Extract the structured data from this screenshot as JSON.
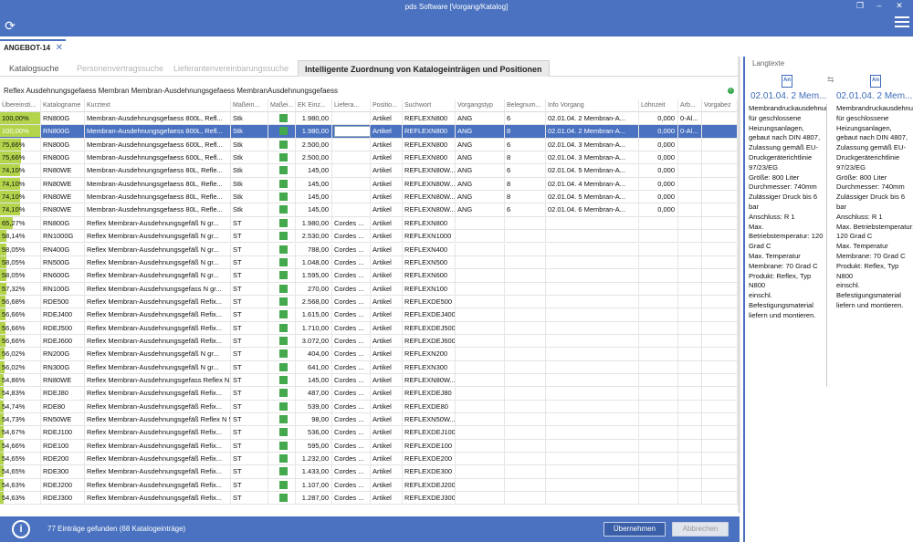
{
  "window": {
    "title": "pds Software [Vorgang/Katalog]"
  },
  "doc_tab": {
    "label": "ANGEBOT-14"
  },
  "subtabs": [
    "Katalogsuche",
    "Personenvertragssuche",
    "Lieferantenvereinbarungssuche",
    "Intelligente Zuordnung von Katalogeinträgen und Positionen"
  ],
  "headline": "Reflex Ausdehnungsgefaess Membran Membran-Ausdehnungsgefaess MembranAusdehnungsgefaess",
  "columns": [
    "Übereinsti...",
    "Katalogname",
    "Kurztext",
    "Maßein...",
    "Maßei...",
    "EK Einz...",
    "Liefera...",
    "Positio...",
    "Suchwort",
    "Vorgangstyp",
    "Belegnum...",
    "Info Vorgang",
    "Löhnzeit",
    "Arb...",
    "Vorgabez"
  ],
  "rows": [
    {
      "match": "100,00%",
      "m": 100,
      "kat": "RN800G",
      "kurz": "Membran-Ausdehnungsgefaess 800L, Refl...",
      "me": "Stk",
      "ek": "1.980,00",
      "lief": "",
      "pos": "Artikel",
      "such": "REFLEXN800",
      "vt": "ANG",
      "bel": "6",
      "info": "02.01.04.    2 Membran-A...",
      "lohn": "0,000",
      "arb": "0-Al...",
      "sel": false
    },
    {
      "match": "100,00%",
      "m": 100,
      "kat": "RN800G",
      "kurz": "Membran-Ausdehnungsgefaess 800L, Refl...",
      "me": "Stk",
      "ek": "1.980,00",
      "lief": "",
      "pos": "Artikel",
      "such": "REFLEXN800",
      "vt": "ANG",
      "bel": "8",
      "info": "02.01.04.    2 Membran-A...",
      "lohn": "0,000",
      "arb": "0-Al...",
      "sel": true
    },
    {
      "match": "75,66%",
      "m": 75.66,
      "kat": "RN800G",
      "kurz": "Membran-Ausdehnungsgefaess 600L, Refl...",
      "me": "Stk",
      "ek": "2.500,00",
      "lief": "",
      "pos": "Artikel",
      "such": "REFLEXN800",
      "vt": "ANG",
      "bel": "6",
      "info": "02.01.04.    3 Membran-A...",
      "lohn": "0,000",
      "arb": "",
      "sel": false
    },
    {
      "match": "75,66%",
      "m": 75.66,
      "kat": "RN800G",
      "kurz": "Membran-Ausdehnungsgefaess 600L, Refl...",
      "me": "Stk",
      "ek": "2.500,00",
      "lief": "",
      "pos": "Artikel",
      "such": "REFLEXN800",
      "vt": "ANG",
      "bel": "8",
      "info": "02.01.04.    3 Membran-A...",
      "lohn": "0,000",
      "arb": "",
      "sel": false
    },
    {
      "match": "74,10%",
      "m": 74.1,
      "kat": "RN80WE",
      "kurz": "Membran-Ausdehnungsgefaess 80L, Refle...",
      "me": "Stk",
      "ek": "145,00",
      "lief": "",
      "pos": "Artikel",
      "such": "REFLEXN80W...",
      "vt": "ANG",
      "bel": "6",
      "info": "02.01.04.    5 Membran-A...",
      "lohn": "0,000",
      "arb": "",
      "sel": false
    },
    {
      "match": "74,10%",
      "m": 74.1,
      "kat": "RN80WE",
      "kurz": "Membran-Ausdehnungsgefaess 80L, Refle...",
      "me": "Stk",
      "ek": "145,00",
      "lief": "",
      "pos": "Artikel",
      "such": "REFLEXN80W...",
      "vt": "ANG",
      "bel": "8",
      "info": "02.01.04.    4 Membran-A...",
      "lohn": "0,000",
      "arb": "",
      "sel": false
    },
    {
      "match": "74,10%",
      "m": 74.1,
      "kat": "RN80WE",
      "kurz": "Membran-Ausdehnungsgefaess 80L, Refle...",
      "me": "Stk",
      "ek": "145,00",
      "lief": "",
      "pos": "Artikel",
      "such": "REFLEXN80W...",
      "vt": "ANG",
      "bel": "8",
      "info": "02.01.04.    5 Membran-A...",
      "lohn": "0,000",
      "arb": "",
      "sel": false
    },
    {
      "match": "74,10%",
      "m": 74.1,
      "kat": "RN80WE",
      "kurz": "Membran-Ausdehnungsgefaess 80L, Refle...",
      "me": "Stk",
      "ek": "145,00",
      "lief": "",
      "pos": "Artikel",
      "such": "REFLEXN80W...",
      "vt": "ANG",
      "bel": "6",
      "info": "02.01.04.    6 Membran-A...",
      "lohn": "0,000",
      "arb": "",
      "sel": false
    },
    {
      "match": "65,27%",
      "m": 65.27,
      "kat": "RN800G",
      "kurz": "Reflex Membran-Ausdehnungsgefäß N gr...",
      "me": "ST",
      "ek": "1.980,00",
      "lief": "Cordes ...",
      "pos": "Artikel",
      "such": "REFLEXN800",
      "vt": "",
      "bel": "",
      "info": "",
      "lohn": "",
      "arb": "",
      "sel": false
    },
    {
      "match": "58,14%",
      "m": 58.14,
      "kat": "RN1000G",
      "kurz": "Reflex Membran-Ausdehnungsgefäß N gr...",
      "me": "ST",
      "ek": "2.530,00",
      "lief": "Cordes ...",
      "pos": "Artikel",
      "such": "REFLEXN1000",
      "vt": "",
      "bel": "",
      "info": "",
      "lohn": "",
      "arb": "",
      "sel": false
    },
    {
      "match": "58,05%",
      "m": 58.05,
      "kat": "RN400G",
      "kurz": "Reflex Membran-Ausdehnungsgefäß N gr...",
      "me": "ST",
      "ek": "788,00",
      "lief": "Cordes ...",
      "pos": "Artikel",
      "such": "REFLEXN400",
      "vt": "",
      "bel": "",
      "info": "",
      "lohn": "",
      "arb": "",
      "sel": false
    },
    {
      "match": "58,05%",
      "m": 58.05,
      "kat": "RN500G",
      "kurz": "Reflex Membran-Ausdehnungsgefäß N gr...",
      "me": "ST",
      "ek": "1.048,00",
      "lief": "Cordes ...",
      "pos": "Artikel",
      "such": "REFLEXN500",
      "vt": "",
      "bel": "",
      "info": "",
      "lohn": "",
      "arb": "",
      "sel": false
    },
    {
      "match": "58,05%",
      "m": 58.05,
      "kat": "RN600G",
      "kurz": "Reflex Membran-Ausdehnungsgefäß N gr...",
      "me": "ST",
      "ek": "1.595,00",
      "lief": "Cordes ...",
      "pos": "Artikel",
      "such": "REFLEXN600",
      "vt": "",
      "bel": "",
      "info": "",
      "lohn": "",
      "arb": "",
      "sel": false
    },
    {
      "match": "57,32%",
      "m": 57.32,
      "kat": "RN100G",
      "kurz": "Reflex Membran-Ausdehnungsgefass N gr...",
      "me": "ST",
      "ek": "270,00",
      "lief": "Cordes ...",
      "pos": "Artikel",
      "such": "REFLEXN100",
      "vt": "",
      "bel": "",
      "info": "",
      "lohn": "",
      "arb": "",
      "sel": false
    },
    {
      "match": "56,68%",
      "m": 56.68,
      "kat": "RDE500",
      "kurz": "Reflex Membran-Ausdehnungsgefäß Refix...",
      "me": "ST",
      "ek": "2.568,00",
      "lief": "Cordes ...",
      "pos": "Artikel",
      "such": "REFLEXDE500",
      "vt": "",
      "bel": "",
      "info": "",
      "lohn": "",
      "arb": "",
      "sel": false
    },
    {
      "match": "56,66%",
      "m": 56.66,
      "kat": "RDEJ400",
      "kurz": "Reflex Membran-Ausdehnungsgefäß Refix...",
      "me": "ST",
      "ek": "1.615,00",
      "lief": "Cordes ...",
      "pos": "Artikel",
      "such": "REFLEXDEJ400",
      "vt": "",
      "bel": "",
      "info": "",
      "lohn": "",
      "arb": "",
      "sel": false
    },
    {
      "match": "56,66%",
      "m": 56.66,
      "kat": "RDEJ500",
      "kurz": "Reflex Membran-Ausdehnungsgefäß Refix...",
      "me": "ST",
      "ek": "1.710,00",
      "lief": "Cordes ...",
      "pos": "Artikel",
      "such": "REFLEXDEJ500",
      "vt": "",
      "bel": "",
      "info": "",
      "lohn": "",
      "arb": "",
      "sel": false
    },
    {
      "match": "56,66%",
      "m": 56.66,
      "kat": "RDEJ600",
      "kurz": "Reflex Membran-Ausdehnungsgefäß Refix...",
      "me": "ST",
      "ek": "3.072,00",
      "lief": "Cordes ...",
      "pos": "Artikel",
      "such": "REFLEXDEJ600",
      "vt": "",
      "bel": "",
      "info": "",
      "lohn": "",
      "arb": "",
      "sel": false
    },
    {
      "match": "56,02%",
      "m": 56.02,
      "kat": "RN200G",
      "kurz": "Reflex Membran-Ausdehnungsgefäß N gr...",
      "me": "ST",
      "ek": "404,00",
      "lief": "Cordes ...",
      "pos": "Artikel",
      "such": "REFLEXN200",
      "vt": "",
      "bel": "",
      "info": "",
      "lohn": "",
      "arb": "",
      "sel": false
    },
    {
      "match": "56,02%",
      "m": 56.02,
      "kat": "RN300G",
      "kurz": "Reflex Membran-Ausdehnungsgefäß N gr...",
      "me": "ST",
      "ek": "641,00",
      "lief": "Cordes ...",
      "pos": "Artikel",
      "such": "REFLEXN300",
      "vt": "",
      "bel": "",
      "info": "",
      "lohn": "",
      "arb": "",
      "sel": false
    },
    {
      "match": "54,86%",
      "m": 54.86,
      "kat": "RN80WE",
      "kurz": "Reflex Membran-Ausdehnungsgefass Reflex N 8...",
      "me": "ST",
      "ek": "145,00",
      "lief": "Cordes ...",
      "pos": "Artikel",
      "such": "REFLEXN80W...",
      "vt": "",
      "bel": "",
      "info": "",
      "lohn": "",
      "arb": "",
      "sel": false
    },
    {
      "match": "54,83%",
      "m": 54.83,
      "kat": "RDEJ80",
      "kurz": "Reflex Membran-Ausdehnungsgefäß Refix...",
      "me": "ST",
      "ek": "487,00",
      "lief": "Cordes ...",
      "pos": "Artikel",
      "such": "REFLEXDEJ80",
      "vt": "",
      "bel": "",
      "info": "",
      "lohn": "",
      "arb": "",
      "sel": false
    },
    {
      "match": "54,74%",
      "m": 54.74,
      "kat": "RDE80",
      "kurz": "Reflex Membran-Ausdehnungsgefäß Refix...",
      "me": "ST",
      "ek": "539,00",
      "lief": "Cordes ...",
      "pos": "Artikel",
      "such": "REFLEXDE80",
      "vt": "",
      "bel": "",
      "info": "",
      "lohn": "",
      "arb": "",
      "sel": false
    },
    {
      "match": "54,73%",
      "m": 54.73,
      "kat": "RN50WE",
      "kurz": "Reflex Membran-Ausdehnungsgefäß Reflex N 5...",
      "me": "ST",
      "ek": "98,00",
      "lief": "Cordes ...",
      "pos": "Artikel",
      "such": "REFLEXN50W...",
      "vt": "",
      "bel": "",
      "info": "",
      "lohn": "",
      "arb": "",
      "sel": false
    },
    {
      "match": "54,67%",
      "m": 54.67,
      "kat": "RDEJ100",
      "kurz": "Reflex Membran-Ausdehnungsgefäß Refix...",
      "me": "ST",
      "ek": "536,00",
      "lief": "Cordes ...",
      "pos": "Artikel",
      "such": "REFLEXDEJ100",
      "vt": "",
      "bel": "",
      "info": "",
      "lohn": "",
      "arb": "",
      "sel": false
    },
    {
      "match": "54,66%",
      "m": 54.66,
      "kat": "RDE100",
      "kurz": "Reflex Membran-Ausdehnungsgefäß Refix...",
      "me": "ST",
      "ek": "595,00",
      "lief": "Cordes ...",
      "pos": "Artikel",
      "such": "REFLEXDE100",
      "vt": "",
      "bel": "",
      "info": "",
      "lohn": "",
      "arb": "",
      "sel": false
    },
    {
      "match": "54,65%",
      "m": 54.65,
      "kat": "RDE200",
      "kurz": "Reflex Membran-Ausdehnungsgefäß Refix...",
      "me": "ST",
      "ek": "1.232,00",
      "lief": "Cordes ...",
      "pos": "Artikel",
      "such": "REFLEXDE200",
      "vt": "",
      "bel": "",
      "info": "",
      "lohn": "",
      "arb": "",
      "sel": false
    },
    {
      "match": "54,65%",
      "m": 54.65,
      "kat": "RDE300",
      "kurz": "Reflex Membran-Ausdehnungsgefäß Refix...",
      "me": "ST",
      "ek": "1.433,00",
      "lief": "Cordes ...",
      "pos": "Artikel",
      "such": "REFLEXDE300",
      "vt": "",
      "bel": "",
      "info": "",
      "lohn": "",
      "arb": "",
      "sel": false
    },
    {
      "match": "54,63%",
      "m": 54.63,
      "kat": "RDEJ200",
      "kurz": "Reflex Membran-Ausdehnungsgefäß Refix...",
      "me": "ST",
      "ek": "1.107,00",
      "lief": "Cordes ...",
      "pos": "Artikel",
      "such": "REFLEXDEJ200",
      "vt": "",
      "bel": "",
      "info": "",
      "lohn": "",
      "arb": "",
      "sel": false
    },
    {
      "match": "54,63%",
      "m": 54.63,
      "kat": "RDEJ300",
      "kurz": "Reflex Membran-Ausdehnungsgefäß Refix...",
      "me": "ST",
      "ek": "1.287,00",
      "lief": "Cordes ...",
      "pos": "Artikel",
      "such": "REFLEXDEJ300",
      "vt": "",
      "bel": "",
      "info": "",
      "lohn": "",
      "arb": "",
      "sel": false
    }
  ],
  "status": {
    "message": "77 Einträge gefunden (68 Katalogeinträge)"
  },
  "buttons": {
    "accept": "Übernehmen",
    "cancel": "Abbrechen"
  },
  "langtexte": {
    "title": "Langtexte",
    "left_head": "02.01.04.    2 Mem...",
    "right_head": "02.01.04.    2 Mem...",
    "left_text": "Membrandruckausdehnungsgefäß für geschlossene Heizungsanlagen, gebaut nach DIN 4807, Zulassung gemäß EU-Druckgeräterichtlinie 97/23/EG\nGröße: 800 Liter\nDurchmesser: 740mm\nZulässiger Druck bis 6 bar\nAnschluss: R 1\nMax. Betriebstemperatur: 120 Grad C\nMax. Temperatur Membrane: 70 Grad C\nProdukt: Reflex, Typ N800\neinschl. Befestigungsmaterial liefern und montieren.",
    "right_text": "Membrandruckausdehnungsgefäß für geschlossene Heizungsanlagen, gebaut nach DIN 4807, Zulassung gemäß EU-Druckgeräterichtlinie 97/23/EG\nGröße: 800 Liter\nDurchmesser: 740mm\nZulässiger Druck bis 6 bar\nAnschluss: R 1\nMax. Betriebstemperatur: 120 Grad C\nMax. Temperatur Membrane: 70 Grad C\nProdukt: Reflex, Typ N800\neinschl. Befestigungsmaterial liefern und montieren."
  },
  "icons": {
    "refresh": "refresh-icon",
    "menu": "hamburger-menu-icon",
    "info": "info-icon",
    "close": "close-icon",
    "langtext": "document-an-icon"
  },
  "colors": {
    "accent": "#4a72c0",
    "match_bar": "#b3d44b",
    "status_square": "#44a84c"
  }
}
